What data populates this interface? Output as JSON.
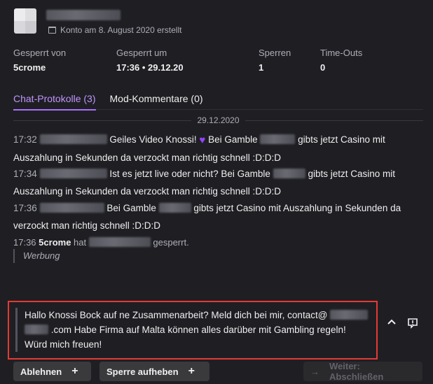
{
  "header": {
    "account_created": "Konto am 8. August 2020 erstellt"
  },
  "stats": [
    {
      "label": "Gesperrt von",
      "value": "5crome"
    },
    {
      "label": "Gesperrt um",
      "value": "17:36 • 29.12.20"
    },
    {
      "label": "Sperren",
      "value": "1"
    },
    {
      "label": "Time-Outs",
      "value": "0"
    }
  ],
  "tabs": [
    {
      "label": "Chat-Protokolle (3)",
      "active": true
    },
    {
      "label": "Mod-Kommentare (0)",
      "active": false
    }
  ],
  "date_separator": "29.12.2020",
  "messages": [
    {
      "time": "17:32",
      "part1": "Geiles Video Knossi!",
      "part2": "Bei Gamble",
      "part3": "gibts jetzt Casino mit Auszahlung in Sekunden da verzockt man richtig schnell :D:D:D"
    },
    {
      "time": "17:34",
      "part1": "Ist es jetzt live oder nicht? Bei Gamble",
      "part3": "gibts jetzt Casino mit Auszahlung in Sekunden da verzockt man richtig schnell :D:D:D"
    },
    {
      "time": "17:36",
      "part1": "Bei Gamble",
      "part3": "gibts jetzt Casino mit Auszahlung in Sekunden da verzockt man richtig schnell :D:D:D"
    }
  ],
  "mod_action": {
    "time": "17:36",
    "moderator": "5crome",
    "verb": "hat",
    "suffix": "gesperrt.",
    "reason": "Werbung"
  },
  "appeal": {
    "text1": "Hallo Knossi Bock auf ne Zusammenarbeit? Meld dich bei mir, contact@",
    "text2": ".com Habe Firma auf Malta können alles darüber mit Gambling regeln! Würd mich freuen!"
  },
  "actions": {
    "reject": "Ablehnen",
    "unban": "Sperre aufheben",
    "next": "Weiter: Abschließen",
    "next_arrow": "→"
  },
  "colors": {
    "accent": "#a970ff",
    "highlight": "#e53935",
    "background": "#1f1f23"
  }
}
